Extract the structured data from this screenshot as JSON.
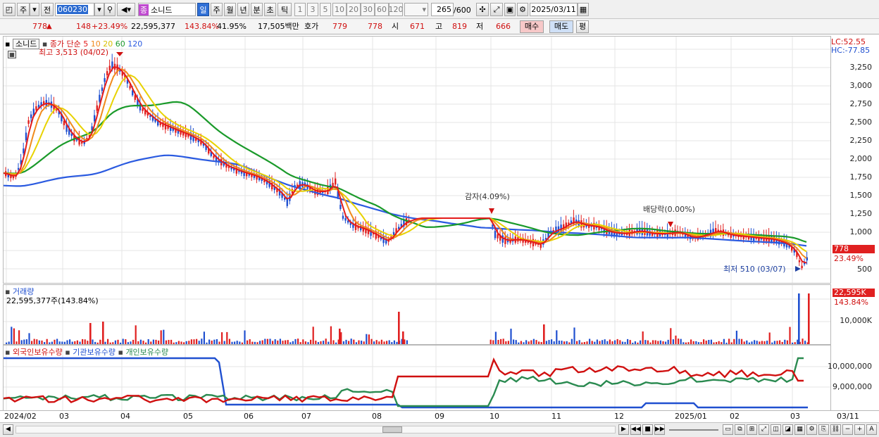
{
  "toolbar": {
    "period_buttons": [
      "주",
      "전"
    ],
    "code_value": "060230",
    "stock_name": "소니드",
    "stock_badge": "종",
    "intervals": [
      "일",
      "주",
      "월",
      "년",
      "분",
      "초",
      "틱"
    ],
    "minute_options": [
      "1",
      "3",
      "5",
      "10",
      "20",
      "30",
      "60",
      "120"
    ],
    "count": "265",
    "count_max": "/600",
    "date": "2025/03/11"
  },
  "quote": {
    "price": "778",
    "change": "148",
    "change_pct": "+23.49%",
    "volume": "22,595,377",
    "vol_ratio": "143.84%",
    "turnover": "41.95%",
    "amount": "17,505백만",
    "ask_label": "호가",
    "ask": "779",
    "bid": "778",
    "open_label": "시",
    "open": "671",
    "high_label": "고",
    "high": "819",
    "low_label": "저",
    "low": "666",
    "buy_label": "매수",
    "sell_label": "매도",
    "eval_label": "평"
  },
  "price_pane": {
    "stock_label": "소니드",
    "legend_prefix": "종가 단순",
    "ma": [
      {
        "period": "5",
        "color": "#e41a1a"
      },
      {
        "period": "10",
        "color": "#f08a1c"
      },
      {
        "period": "20",
        "color": "#e8d200"
      },
      {
        "period": "60",
        "color": "#1a9a2a"
      },
      {
        "period": "120",
        "color": "#2a5ae0"
      }
    ],
    "high_note": "최고 3,513 (04/02)",
    "low_note": "최저 510 (03/07)",
    "annotation_1": "감자(4.09%)",
    "annotation_2": "배당락(0.00%)",
    "lc": "LC:52.55",
    "hc": "HC:-77.85",
    "last_price": "778",
    "last_pct": "23.49%",
    "ticks": [
      "3,250",
      "3,000",
      "2,750",
      "2,500",
      "2,250",
      "2,000",
      "1,750",
      "1,500",
      "1,250",
      "1,000",
      "500"
    ]
  },
  "volume_pane": {
    "title": "거래량",
    "current": "22,595,377주(143.84%)",
    "last": "22,595K",
    "last_pct": "143.84%",
    "tick": "10,000K"
  },
  "holding_pane": {
    "legend": [
      "외국인보유수량",
      "기관보유수량",
      "개인보유수량"
    ],
    "colors": [
      "#d01010",
      "#2050d0",
      "#2a8a50"
    ],
    "ticks": [
      "10,000,000",
      "9,000,000"
    ]
  },
  "x_axis": [
    "2024/02",
    "03",
    "04",
    "05",
    "06",
    "07",
    "08",
    "09",
    "10",
    "11",
    "12",
    "2025/01",
    "02",
    "03",
    "03/11"
  ]
}
